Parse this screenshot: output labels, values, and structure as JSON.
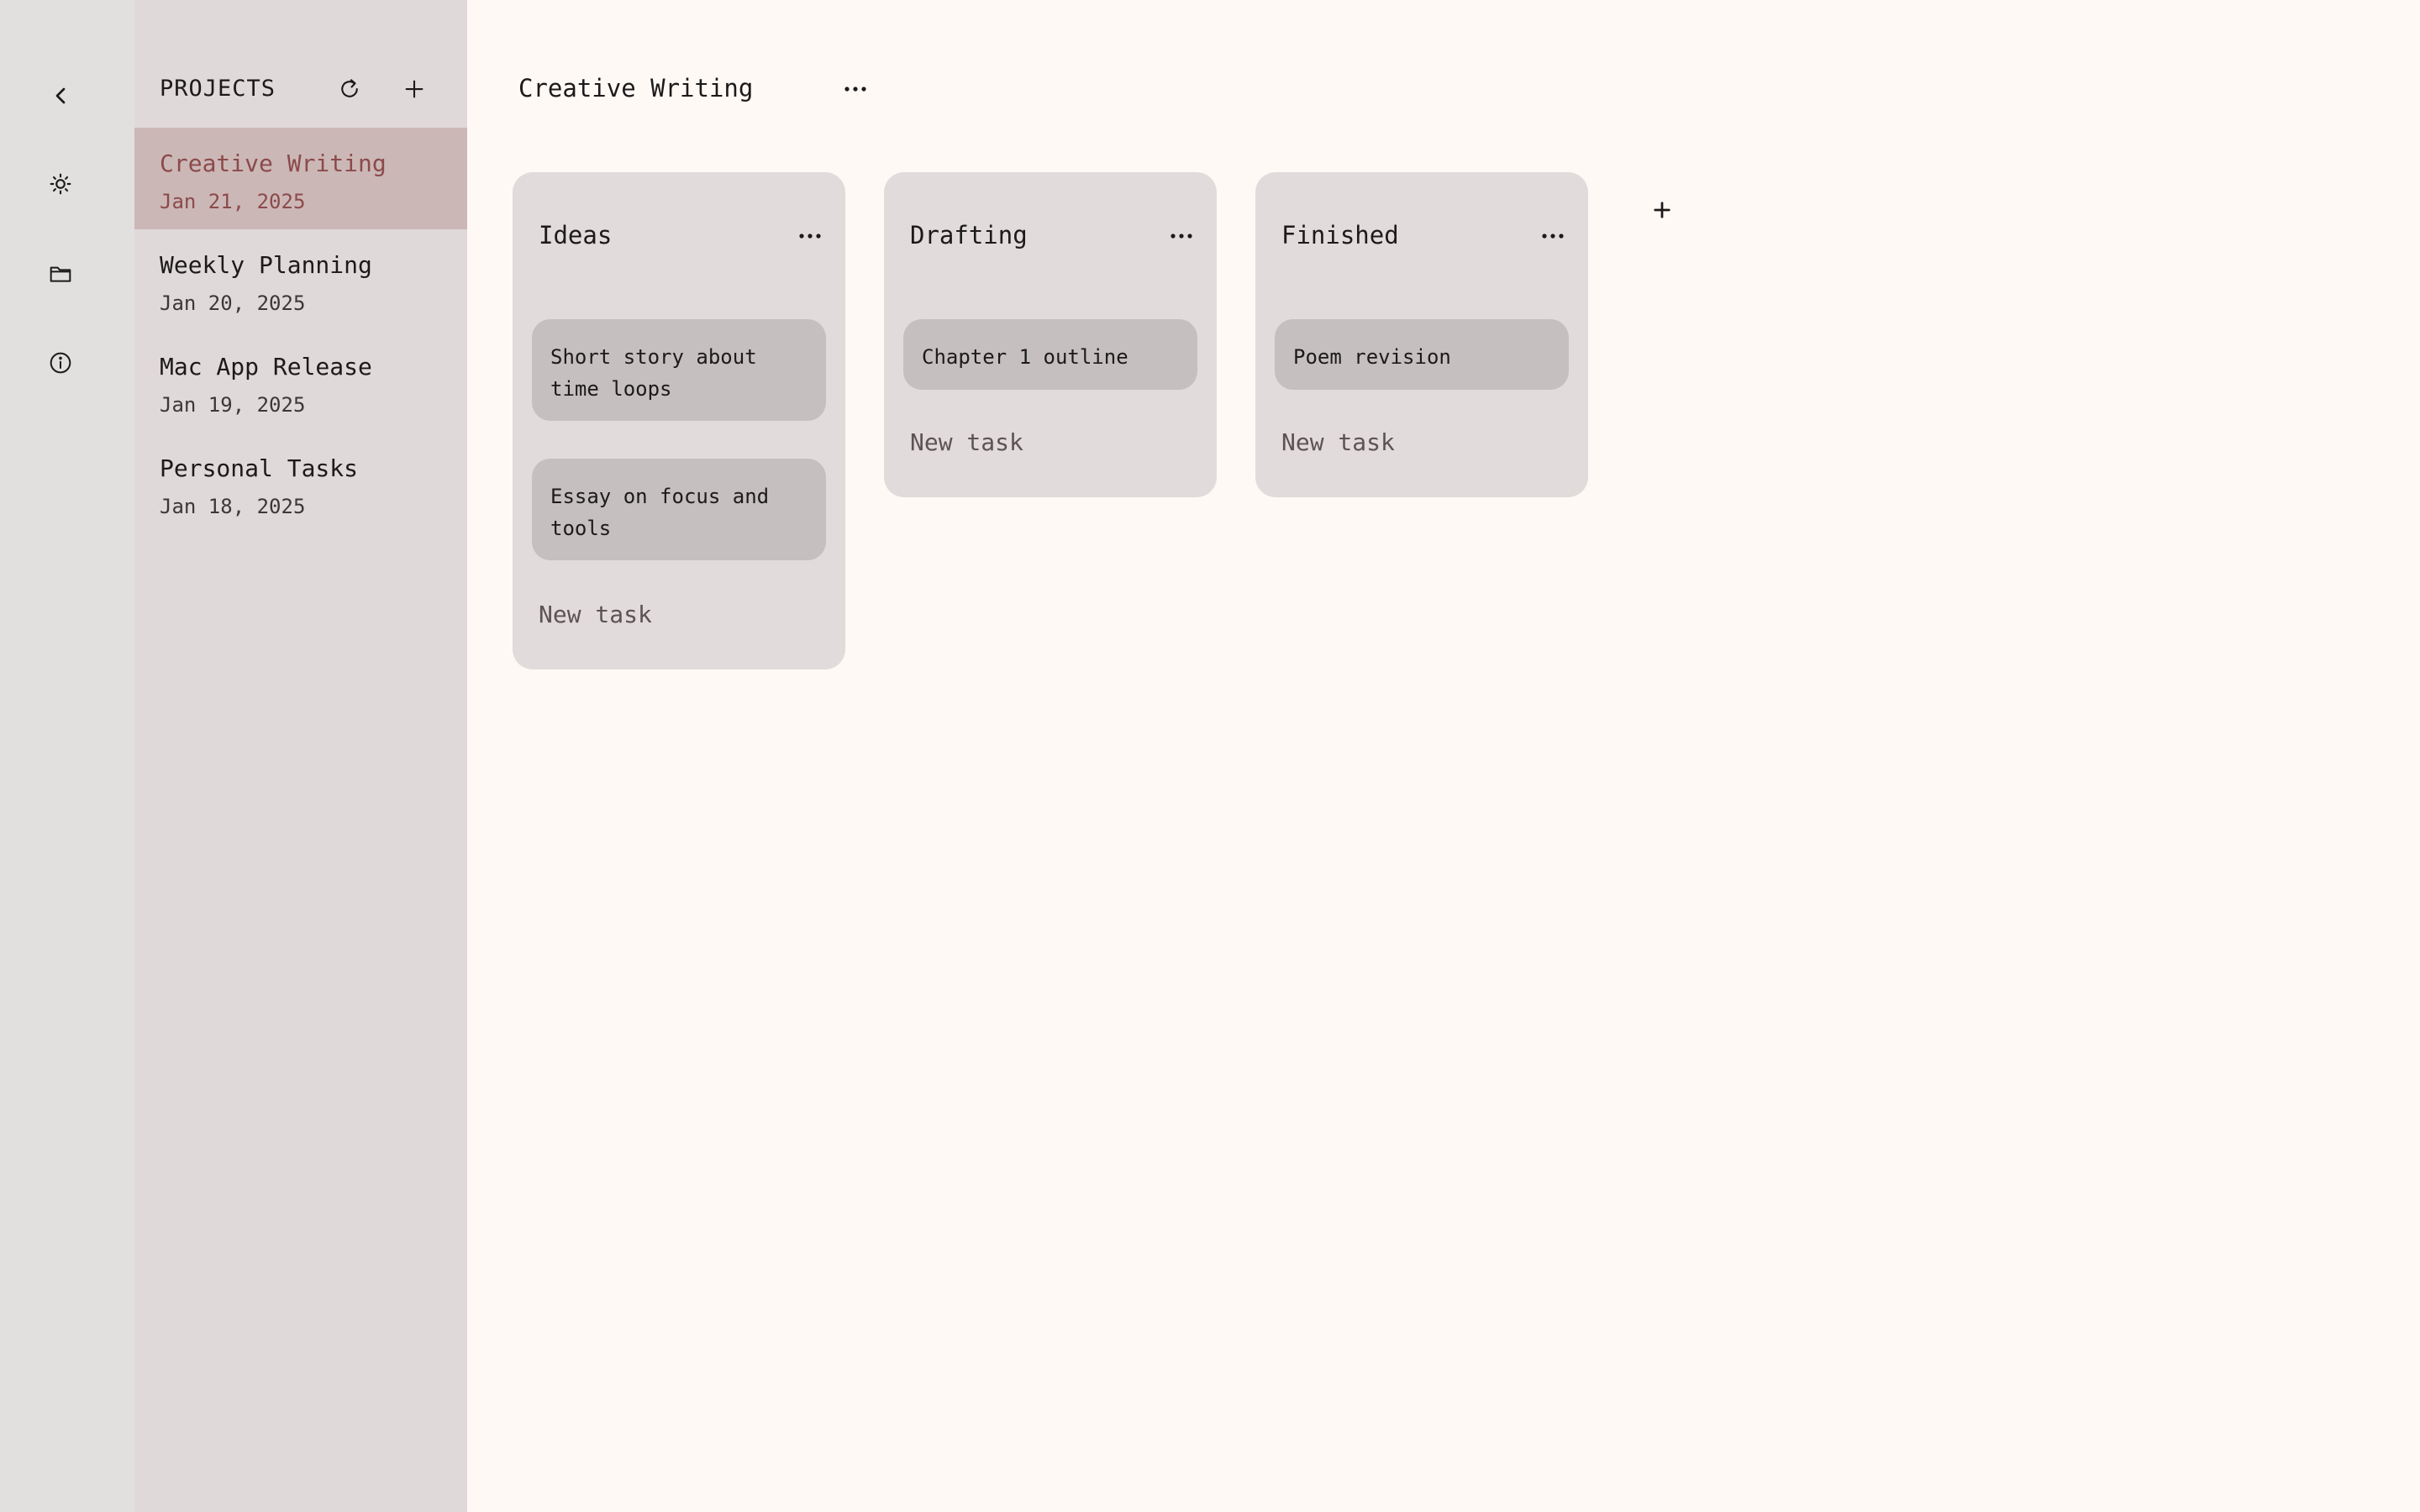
{
  "rail": {
    "icons": [
      "chevron-left-icon",
      "sun-icon",
      "folder-icon",
      "info-icon"
    ]
  },
  "sidebar": {
    "title": "PROJECTS",
    "icons": [
      "refresh-icon",
      "plus-icon"
    ],
    "projects": [
      {
        "name": "Creative Writing",
        "date": "Jan 21, 2025",
        "active": true
      },
      {
        "name": "Weekly Planning",
        "date": "Jan 20, 2025",
        "active": false
      },
      {
        "name": "Mac App Release",
        "date": "Jan 19, 2025",
        "active": false
      },
      {
        "name": "Personal Tasks",
        "date": "Jan 18, 2025",
        "active": false
      }
    ]
  },
  "board": {
    "title": "Creative Writing",
    "columns": [
      {
        "title": "Ideas",
        "cards": [
          "Short story about time loops",
          "Essay on focus and tools"
        ],
        "new_task": "New task"
      },
      {
        "title": "Drafting",
        "cards": [
          "Chapter 1 outline"
        ],
        "new_task": "New task"
      },
      {
        "title": "Finished",
        "cards": [
          "Poem revision"
        ],
        "new_task": "New task"
      }
    ]
  },
  "colors": {
    "background": "#fff9f5",
    "rail": "#e2dfdf",
    "sidebar": "#e0d9da",
    "active_item": "#ccb7b7",
    "accent_text": "#8c4a4a",
    "column": "#e1dbdb",
    "card": "#c5bfbf"
  }
}
